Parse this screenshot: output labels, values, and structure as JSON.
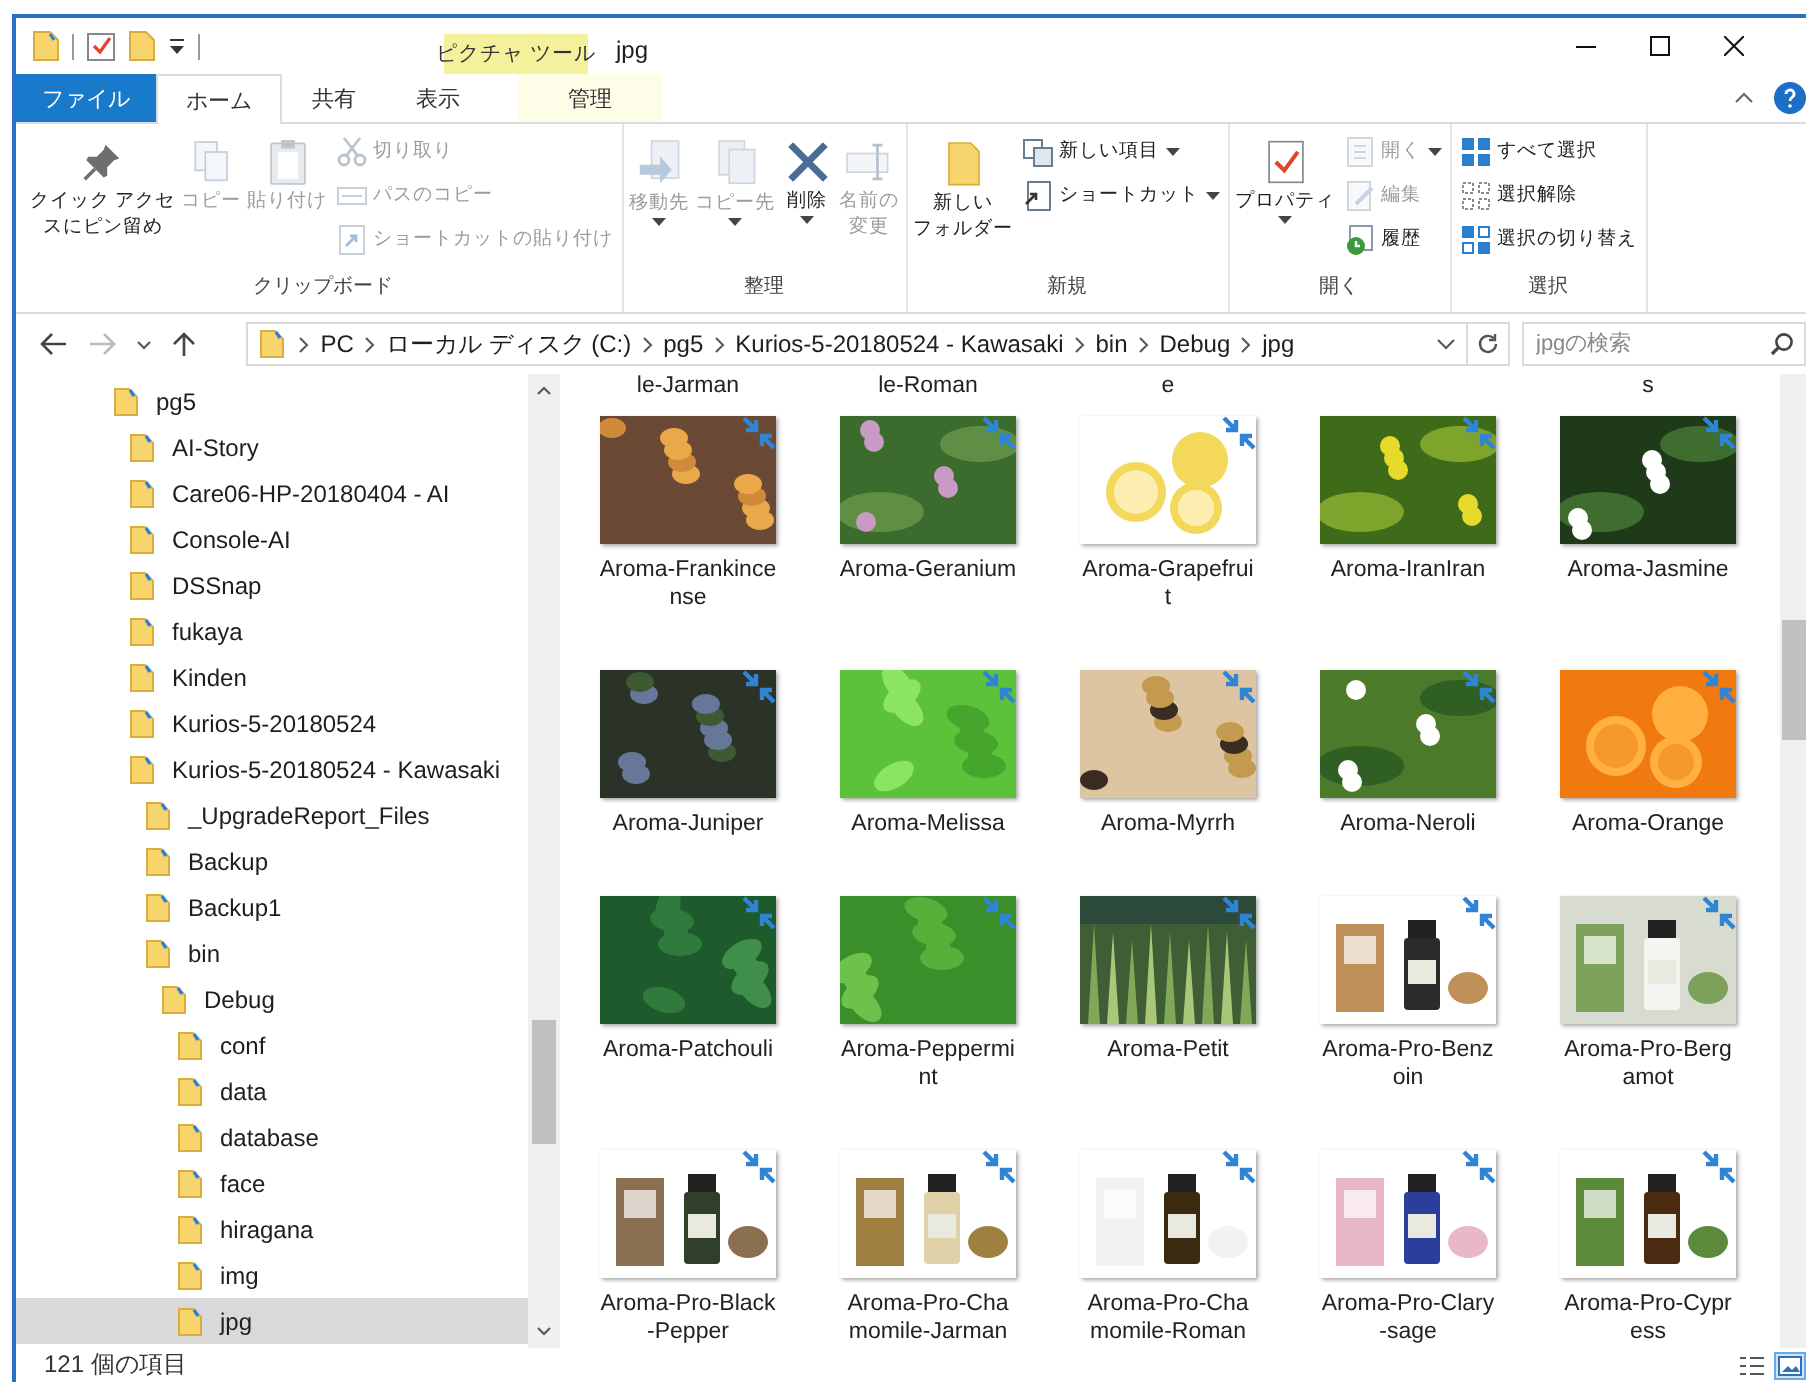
{
  "window": {
    "title": "jpg",
    "context_group": "ピクチャ ツール"
  },
  "tabs": [
    {
      "label": "ファイル",
      "kind": "file",
      "selected": false
    },
    {
      "label": "ホーム",
      "kind": "normal",
      "selected": true
    },
    {
      "label": "共有",
      "kind": "normal",
      "selected": false
    },
    {
      "label": "表示",
      "kind": "normal",
      "selected": false
    },
    {
      "label": "管理",
      "kind": "contextual",
      "selected": false
    }
  ],
  "ribbon": {
    "groups": [
      {
        "label": "クリップボード",
        "buttons": [
          {
            "lines": [
              "クイック アクセ",
              "スにピン留め"
            ],
            "kind": "large",
            "disabled": false,
            "dropdown": false
          },
          {
            "label": "コピー",
            "kind": "large",
            "disabled": true,
            "dropdown": false
          },
          {
            "label": "貼り付け",
            "kind": "large",
            "disabled": true,
            "dropdown": false
          },
          {
            "label": "切り取り",
            "kind": "small",
            "disabled": true,
            "dropdown": false
          },
          {
            "label": "パスのコピー",
            "kind": "small",
            "disabled": true,
            "dropdown": false
          },
          {
            "label": "ショートカットの貼り付け",
            "kind": "small",
            "disabled": true,
            "dropdown": false
          }
        ]
      },
      {
        "label": "整理",
        "buttons": [
          {
            "label": "移動先",
            "kind": "large",
            "disabled": true,
            "dropdown": true
          },
          {
            "label": "コピー先",
            "kind": "large",
            "disabled": true,
            "dropdown": true
          },
          {
            "label": "削除",
            "kind": "large",
            "disabled": false,
            "dropdown": true
          },
          {
            "lines": [
              "名前の",
              "変更"
            ],
            "kind": "large",
            "disabled": true,
            "dropdown": false
          }
        ]
      },
      {
        "label": "新規",
        "buttons": [
          {
            "lines": [
              "新しい",
              "フォルダー"
            ],
            "kind": "large",
            "disabled": false,
            "dropdown": false
          },
          {
            "label": "新しい項目",
            "kind": "small",
            "disabled": false,
            "dropdown": true
          },
          {
            "label": "ショートカット",
            "kind": "small",
            "disabled": false,
            "dropdown": true
          }
        ]
      },
      {
        "label": "開く",
        "buttons": [
          {
            "label": "プロパティ",
            "kind": "large",
            "disabled": false,
            "dropdown": true
          },
          {
            "label": "開く",
            "kind": "small",
            "disabled": true,
            "dropdown": true
          },
          {
            "label": "編集",
            "kind": "small",
            "disabled": true,
            "dropdown": false
          },
          {
            "label": "履歴",
            "kind": "small",
            "disabled": false,
            "dropdown": false
          }
        ]
      },
      {
        "label": "選択",
        "buttons": [
          {
            "label": "すべて選択",
            "kind": "small",
            "disabled": false,
            "dropdown": false
          },
          {
            "label": "選択解除",
            "kind": "small",
            "disabled": false,
            "dropdown": false
          },
          {
            "label": "選択の切り替え",
            "kind": "small",
            "disabled": false,
            "dropdown": false
          }
        ]
      }
    ]
  },
  "address": {
    "path": [
      "PC",
      "ローカル ディスク (C:)",
      "pg5",
      "Kurios-5-20180524 - Kawasaki",
      "bin",
      "Debug",
      "jpg"
    ],
    "search": {
      "placeholder": "jpgの検索"
    }
  },
  "nav_tree": [
    {
      "label": "pg5",
      "selected": false,
      "children": [
        {
          "label": "AI-Story",
          "selected": false
        },
        {
          "label": "Care06-HP-20180404 - AI",
          "selected": false
        },
        {
          "label": "Console-AI",
          "selected": false
        },
        {
          "label": "DSSnap",
          "selected": false
        },
        {
          "label": "fukaya",
          "selected": false
        },
        {
          "label": "Kinden",
          "selected": false
        },
        {
          "label": "Kurios-5-20180524",
          "selected": false
        },
        {
          "label": "Kurios-5-20180524 - Kawasaki",
          "selected": false,
          "children": [
            {
              "label": "_UpgradeReport_Files",
              "selected": false
            },
            {
              "label": "Backup",
              "selected": false
            },
            {
              "label": "Backup1",
              "selected": false
            },
            {
              "label": "bin",
              "selected": false,
              "children": [
                {
                  "label": "Debug",
                  "selected": false,
                  "children": [
                    {
                      "label": "conf",
                      "selected": false
                    },
                    {
                      "label": "data",
                      "selected": false
                    },
                    {
                      "label": "database",
                      "selected": false
                    },
                    {
                      "label": "face",
                      "selected": false
                    },
                    {
                      "label": "hiragana",
                      "selected": false
                    },
                    {
                      "label": "img",
                      "selected": false
                    },
                    {
                      "label": "jpg",
                      "selected": true
                    }
                  ]
                }
              ]
            }
          ]
        }
      ]
    }
  ],
  "files": {
    "partial_row": [
      {
        "label": "le-Jarman"
      },
      {
        "label": "le-Roman"
      },
      {
        "label": "e"
      },
      {
        "label": "s"
      }
    ],
    "items": [
      {
        "label": "Aroma-Frankincense",
        "compressed": true
      },
      {
        "label": "Aroma-Geranium",
        "compressed": true
      },
      {
        "label": "Aroma-Grapefruit",
        "compressed": true
      },
      {
        "label": "Aroma-IranIran",
        "compressed": true
      },
      {
        "label": "Aroma-Jasmine",
        "compressed": true
      },
      {
        "label": "Aroma-Juniper",
        "compressed": true
      },
      {
        "label": "Aroma-Melissa",
        "compressed": true
      },
      {
        "label": "Aroma-Myrrh",
        "compressed": true
      },
      {
        "label": "Aroma-Neroli",
        "compressed": true
      },
      {
        "label": "Aroma-Orange",
        "compressed": true
      },
      {
        "label": "Aroma-Patchouli",
        "compressed": true
      },
      {
        "label": "Aroma-Peppermint",
        "compressed": true
      },
      {
        "label": "Aroma-Petit",
        "compressed": true
      },
      {
        "label": "Aroma-Pro-Benzoin",
        "compressed": true
      },
      {
        "label": "Aroma-Pro-Bergamot",
        "compressed": true
      },
      {
        "label": "Aroma-Pro-Black-Pepper",
        "compressed": true
      },
      {
        "label": "Aroma-Pro-Chamomile-Jarman",
        "compressed": true
      },
      {
        "label": "Aroma-Pro-Chamomile-Roman",
        "compressed": true
      },
      {
        "label": "Aroma-Pro-Clary-sage",
        "compressed": true
      },
      {
        "label": "Aroma-Pro-Cypress",
        "compressed": true
      }
    ]
  },
  "status_bar": {
    "item_count": "121 個の項目",
    "views": [
      {
        "kind": "details",
        "selected": false
      },
      {
        "kind": "large_icons",
        "selected": true
      }
    ]
  }
}
